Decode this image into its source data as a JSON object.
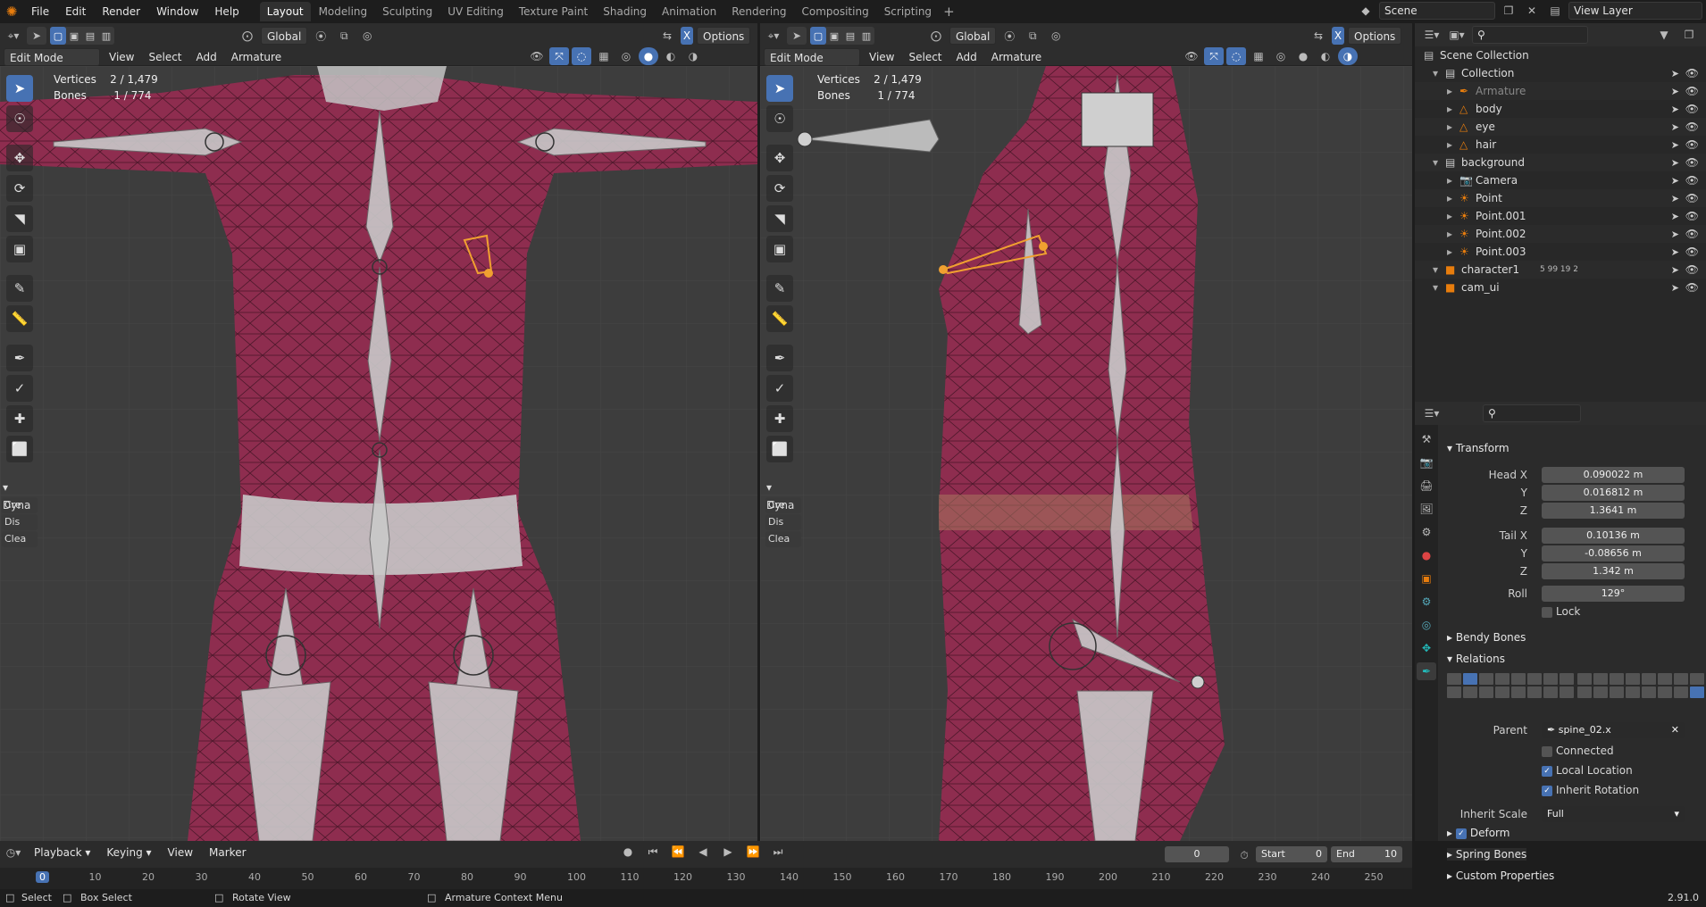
{
  "topbar": {
    "menus": [
      "File",
      "Edit",
      "Render",
      "Window",
      "Help"
    ],
    "workspaces": [
      "Layout",
      "Modeling",
      "Sculpting",
      "UV Editing",
      "Texture Paint",
      "Shading",
      "Animation",
      "Rendering",
      "Compositing",
      "Scripting"
    ],
    "active_workspace": "Layout",
    "scene": "Scene",
    "view_layer": "View Layer"
  },
  "viewport_left": {
    "orientation": "Global",
    "options": "Options",
    "mode": "Edit Mode",
    "menus": [
      "View",
      "Select",
      "Add",
      "Armature"
    ],
    "stats": {
      "vertices_label": "Vertices",
      "vertices": "2 / 1,479",
      "bones_label": "Bones",
      "bones": "1 / 774"
    },
    "dyna": {
      "title": "Dyna",
      "buttons": [
        "Cre",
        "Dis",
        "Clea"
      ]
    }
  },
  "viewport_right": {
    "orientation": "Global",
    "options": "Options",
    "mode": "Edit Mode",
    "menus": [
      "View",
      "Select",
      "Add",
      "Armature"
    ],
    "stats": {
      "vertices_label": "Vertices",
      "vertices": "2 / 1,479",
      "bones_label": "Bones",
      "bones": "1 / 774"
    },
    "dyna": {
      "title": "Dyna",
      "buttons": [
        "Cre",
        "Dis",
        "Clea"
      ]
    }
  },
  "outliner": {
    "root": "Scene Collection",
    "items": [
      {
        "name": "Collection",
        "level": 1,
        "icon": "collection-icon"
      },
      {
        "name": "Armature",
        "level": 2,
        "icon": "armature-icon",
        "dim": true
      },
      {
        "name": "body",
        "level": 2,
        "icon": "mesh-icon"
      },
      {
        "name": "eye",
        "level": 2,
        "icon": "mesh-icon"
      },
      {
        "name": "hair",
        "level": 2,
        "icon": "mesh-icon"
      },
      {
        "name": "background",
        "level": 1,
        "icon": "collection-icon"
      },
      {
        "name": "Camera",
        "level": 2,
        "icon": "camera-icon"
      },
      {
        "name": "Point",
        "level": 2,
        "icon": "light-icon"
      },
      {
        "name": "Point.001",
        "level": 2,
        "icon": "light-icon"
      },
      {
        "name": "Point.002",
        "level": 2,
        "icon": "light-icon"
      },
      {
        "name": "Point.003",
        "level": 2,
        "icon": "light-icon"
      },
      {
        "name": "character1",
        "level": 1,
        "icon": "object-icon"
      },
      {
        "name": "cam_ui",
        "level": 1,
        "icon": "object-icon"
      }
    ],
    "character1_counts": [
      "5",
      "99",
      "19",
      "2"
    ]
  },
  "properties": {
    "transform_title": "Transform",
    "head_x_label": "Head X",
    "head_x": "0.090022 m",
    "head_y_label": "Y",
    "head_y": "0.016812 m",
    "head_z_label": "Z",
    "head_z": "1.3641 m",
    "tail_x_label": "Tail X",
    "tail_x": "0.10136 m",
    "tail_y_label": "Y",
    "tail_y": "-0.08656 m",
    "tail_z_label": "Z",
    "tail_z": "1.342 m",
    "roll_label": "Roll",
    "roll": "129°",
    "lock_label": "Lock",
    "bendy_title": "Bendy Bones",
    "relations_title": "Relations",
    "parent_label": "Parent",
    "parent": "spine_02.x",
    "connected_label": "Connected",
    "local_location_label": "Local Location",
    "inherit_rotation_label": "Inherit Rotation",
    "inherit_scale_label": "Inherit Scale",
    "inherit_scale": "Full",
    "deform_title": "Deform",
    "spring_title": "Spring Bones",
    "custom_title": "Custom Properties"
  },
  "timeline": {
    "menus": [
      "Playback",
      "Keying",
      "View",
      "Marker"
    ],
    "current_frame": "0",
    "start_label": "Start",
    "start": "0",
    "end_label": "End",
    "end": "10",
    "ruler": [
      "0",
      "10",
      "20",
      "30",
      "40",
      "50",
      "60",
      "70",
      "80",
      "90",
      "100",
      "110",
      "120",
      "130",
      "140",
      "150",
      "160",
      "170",
      "180",
      "190",
      "200",
      "210",
      "220",
      "230",
      "240",
      "250"
    ]
  },
  "statusbar": {
    "select": "Select",
    "box_select": "Box Select",
    "rotate_view": "Rotate View",
    "context_menu": "Armature Context Menu",
    "version": "2.91.0"
  },
  "colors": {
    "accent": "#4772b3",
    "body_mesh": "#8e2d4f",
    "bone": "#b8b8b8",
    "selected": "#f0a030"
  }
}
